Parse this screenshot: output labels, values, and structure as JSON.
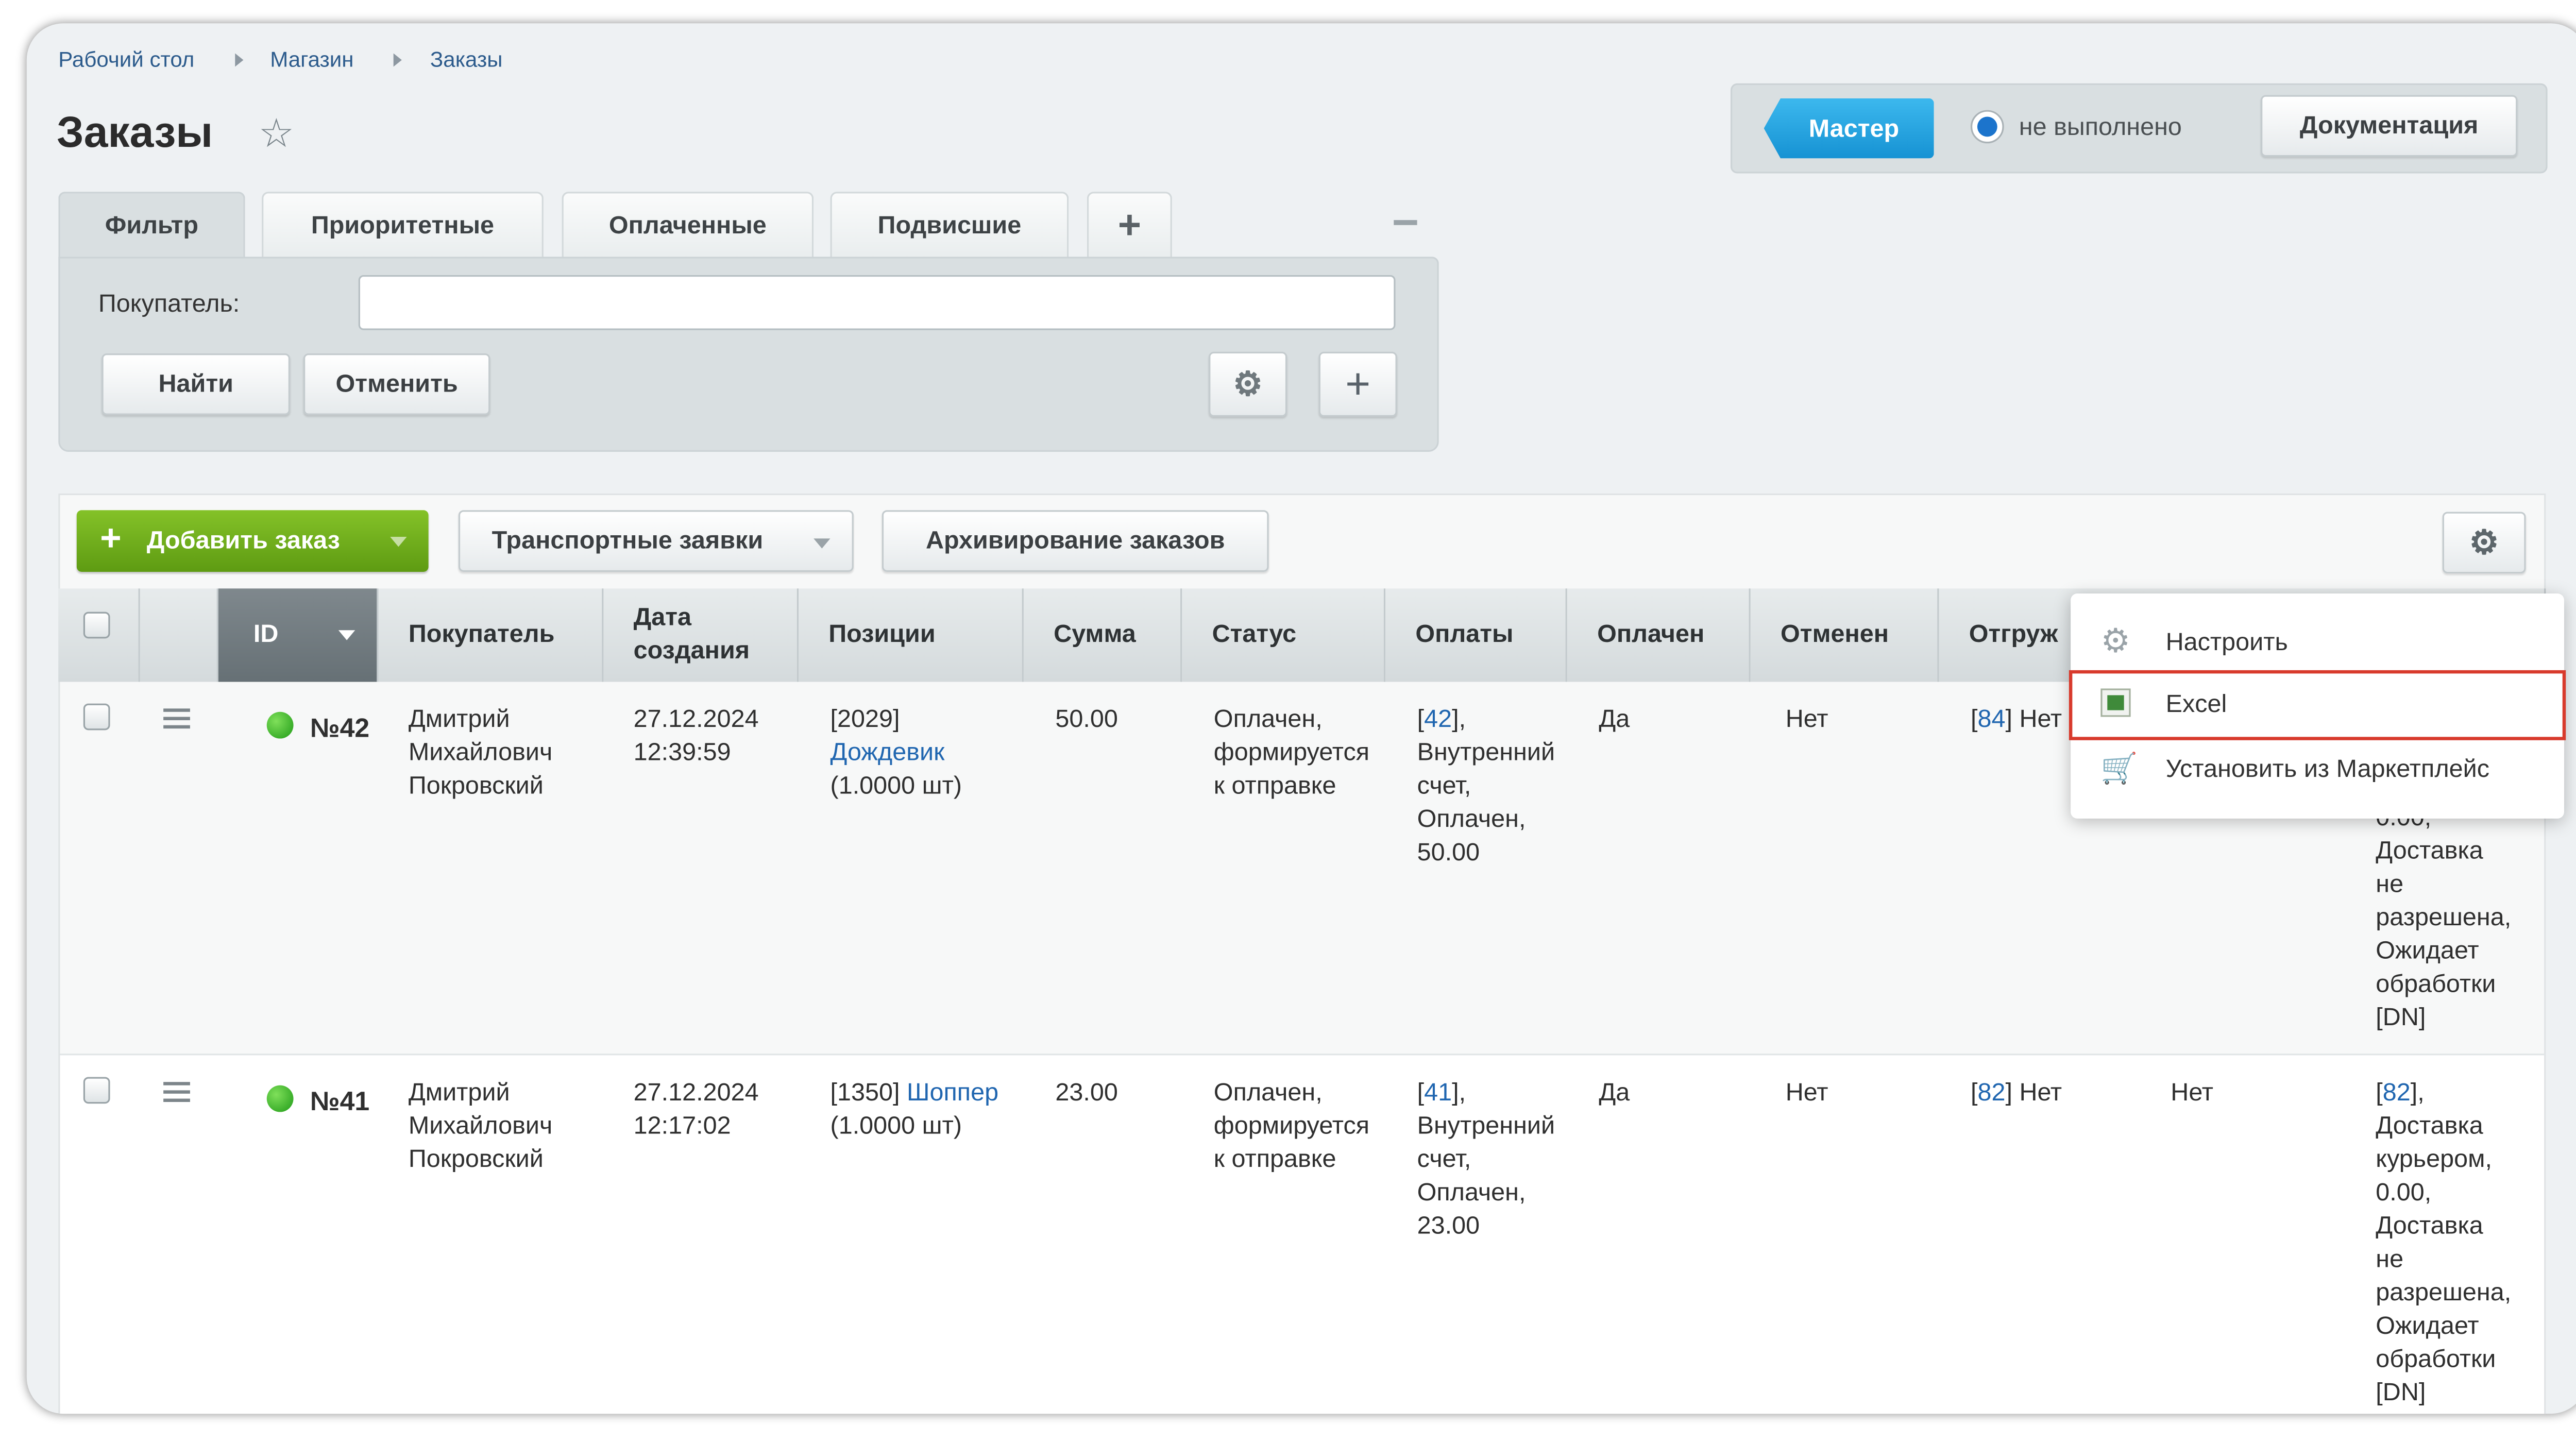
{
  "breadcrumbs": [
    "Рабочий стол",
    "Магазин",
    "Заказы"
  ],
  "page_title": "Заказы",
  "top_panel": {
    "master_label": "Мастер",
    "status_label": "не выполнено",
    "docs_label": "Документация"
  },
  "filter": {
    "tabs": [
      "Фильтр",
      "Приоритетные",
      "Оплаченные",
      "Подвисшие"
    ],
    "buyer_label": "Покупатель:",
    "buyer_value": "",
    "find_label": "Найти",
    "cancel_label": "Отменить"
  },
  "toolbar": {
    "add_order_label": "Добавить заказ",
    "transport_label": "Транспортные заявки",
    "archive_label": "Архивирование заказов"
  },
  "table": {
    "headers": {
      "id": "ID",
      "buyer": "Покупатель",
      "date_1": "Дата",
      "date_2": "создания",
      "positions": "Позиции",
      "sum": "Сумма",
      "status": "Статус",
      "payments": "Оплаты",
      "paid": "Оплачен",
      "canceled": "Отменен",
      "shipment": "Отгруж"
    },
    "rows": [
      {
        "id": "№42",
        "buyer": [
          "Дмитрий",
          "Михайлович",
          "Покровский"
        ],
        "date": [
          "27.12.2024",
          "12:39:59"
        ],
        "pos_code": "[2029]",
        "pos_name": "Дождевик",
        "pos_qty": "(1.0000 шт)",
        "sum": "50.00",
        "status": [
          "Оплачен,",
          "формируется",
          "к отправке"
        ],
        "pay_id": "42",
        "pay_rest": [
          "Внутренний",
          "счет,",
          "Оплачен,",
          "50.00"
        ],
        "paid": "Да",
        "canceled": "Нет",
        "ship_id": "84",
        "ship_text": "Нет",
        "delivery_visible": [
          "0.00,",
          "Доставка",
          "не",
          "разрешена,",
          "Ожидает",
          "обработки",
          "[DN]"
        ]
      },
      {
        "id": "№41",
        "buyer": [
          "Дмитрий",
          "Михайлович",
          "Покровский"
        ],
        "date": [
          "27.12.2024",
          "12:17:02"
        ],
        "pos_code": "[1350]",
        "pos_name": "Шоппер",
        "pos_qty": "(1.0000 шт)",
        "sum": "23.00",
        "status": [
          "Оплачен,",
          "формируется",
          "к отправке"
        ],
        "pay_id": "41",
        "pay_rest": [
          "Внутренний",
          "счет,",
          "Оплачен,",
          "23.00"
        ],
        "paid": "Да",
        "canceled": "Нет",
        "ship_id": "82",
        "ship_text": "Нет",
        "extra_col": "Нет",
        "delivery_id": "82",
        "delivery": [
          "Доставка",
          "курьером,",
          "0.00,",
          "Доставка",
          "не",
          "разрешена,",
          "Ожидает",
          "обработки",
          "[DN]"
        ]
      }
    ]
  },
  "settings_menu": {
    "items": [
      {
        "label": "Настроить",
        "icon": "gear-icon"
      },
      {
        "label": "Excel",
        "icon": "excel-icon",
        "highlighted": true
      },
      {
        "label": "Установить из Маркетплейс",
        "icon": "cart-icon"
      }
    ]
  },
  "colors": {
    "link": "#2066b0",
    "add_button": "#6fae17",
    "master_button": "#1aa0de",
    "highlight_border": "#d83a2c"
  }
}
